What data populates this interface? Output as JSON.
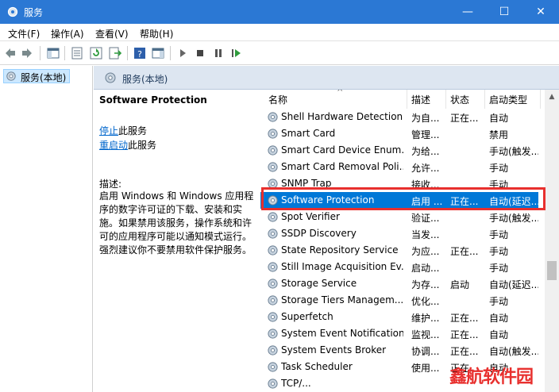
{
  "window": {
    "title": "服务",
    "minimize": "—",
    "maximize": "☐",
    "close": "✕"
  },
  "menu": [
    "文件(F)",
    "操作(A)",
    "查看(V)",
    "帮助(H)"
  ],
  "tree": {
    "root": "服务(本地)"
  },
  "panel_header": "服务(本地)",
  "details": {
    "service_name": "Software Protection",
    "stop_link": "停止",
    "stop_suffix": "此服务",
    "restart_link": "重启动",
    "restart_suffix": "此服务",
    "desc_label": "描述:",
    "desc_text": "启用 Windows 和 Windows 应用程序的数字许可证的下载、安装和实施。如果禁用该服务，操作系统和许可的应用程序可能以通知模式运行。强烈建议你不要禁用软件保护服务。"
  },
  "columns": {
    "name": "名称",
    "desc": "描述",
    "status": "状态",
    "startup": "启动类型",
    "sort_glyph": "^"
  },
  "rows": [
    {
      "name": "Shell Hardware Detection",
      "desc": "为自...",
      "status": "正在...",
      "startup": "自动"
    },
    {
      "name": "Smart Card",
      "desc": "管理...",
      "status": "",
      "startup": "禁用"
    },
    {
      "name": "Smart Card Device Enum...",
      "desc": "为给...",
      "status": "",
      "startup": "手动(触发..."
    },
    {
      "name": "Smart Card Removal Poli...",
      "desc": "允许...",
      "status": "",
      "startup": "手动"
    },
    {
      "name": "SNMP Trap",
      "desc": "接收...",
      "status": "",
      "startup": "手动"
    },
    {
      "name": "Software Protection",
      "desc": "启用 ...",
      "status": "正在...",
      "startup": "自动(延迟..."
    },
    {
      "name": "Spot Verifier",
      "desc": "验证...",
      "status": "",
      "startup": "手动(触发..."
    },
    {
      "name": "SSDP Discovery",
      "desc": "当发...",
      "status": "",
      "startup": "手动"
    },
    {
      "name": "State Repository Service",
      "desc": "为应...",
      "status": "正在...",
      "startup": "手动"
    },
    {
      "name": "Still Image Acquisition Ev...",
      "desc": "启动...",
      "status": "",
      "startup": "手动"
    },
    {
      "name": "Storage Service",
      "desc": "为存...",
      "status": "启动",
      "startup": "自动(延迟..."
    },
    {
      "name": "Storage Tiers Managem...",
      "desc": "优化...",
      "status": "",
      "startup": "手动"
    },
    {
      "name": "Superfetch",
      "desc": "维护...",
      "status": "正在...",
      "startup": "自动"
    },
    {
      "name": "System Event Notification...",
      "desc": "监视...",
      "status": "正在...",
      "startup": "自动"
    },
    {
      "name": "System Events Broker",
      "desc": "协调...",
      "status": "正在...",
      "startup": "自动(触发..."
    },
    {
      "name": "Task Scheduler",
      "desc": "使用...",
      "status": "正在...",
      "startup": "自动"
    },
    {
      "name": "TCP/...",
      "desc": "",
      "status": "",
      "startup": ""
    }
  ],
  "selected_index": 5,
  "watermark": "鑫航软件园",
  "colors": {
    "titlebar": "#2b78d4",
    "selection": "#0078d7",
    "highlight_box": "#e8302e",
    "header_band": "#dde6f1"
  }
}
